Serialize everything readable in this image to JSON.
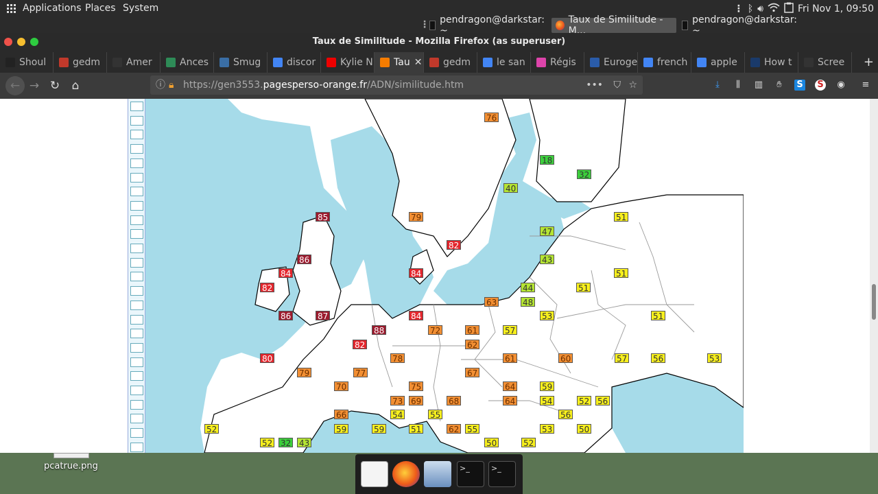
{
  "top_panel": {
    "menus": [
      "Applications",
      "Places",
      "System"
    ],
    "clock": "Fri Nov 1, 09:50"
  },
  "window_list": [
    {
      "label": "pendragon@darkstar: ~",
      "active": false
    },
    {
      "label": "Taux de Similitude - M...",
      "active": true
    },
    {
      "label": "pendragon@darkstar: ~",
      "active": false
    }
  ],
  "window": {
    "title": "Taux de Similitude - Mozilla Firefox (as superuser)"
  },
  "tabs": [
    {
      "label": "Shoul",
      "color": "#222"
    },
    {
      "label": "gedm",
      "color": "#c0392b"
    },
    {
      "label": "Amer",
      "color": "#333"
    },
    {
      "label": "Ances",
      "color": "#2e8b57"
    },
    {
      "label": "Smug",
      "color": "#3a6ea5"
    },
    {
      "label": "discor",
      "color": "#4285f4"
    },
    {
      "label": "Kylie N",
      "color": "#e00"
    },
    {
      "label": "Tau",
      "color": "#f57c00",
      "active": true
    },
    {
      "label": "gedm",
      "color": "#c0392b"
    },
    {
      "label": "le san",
      "color": "#4285f4"
    },
    {
      "label": "Régis",
      "color": "#d4a"
    },
    {
      "label": "Euroge",
      "color": "#2a5caa"
    },
    {
      "label": "french",
      "color": "#4285f4"
    },
    {
      "label": "apple",
      "color": "#4285f4"
    },
    {
      "label": "How t",
      "color": "#1a3a6a"
    },
    {
      "label": "Scree",
      "color": "#333"
    }
  ],
  "url": {
    "prefix": "https://gen3553.",
    "domain": "pagesperso-orange.fr",
    "path": "/ADN/similitude.htm"
  },
  "desktop": {
    "file_label": "pcatrue.png"
  },
  "map": {
    "sea_color": "#a6dbe9",
    "labels": [
      {
        "v": "76",
        "c": "orange"
      },
      {
        "v": "18",
        "c": "green"
      },
      {
        "v": "32",
        "c": "green"
      },
      {
        "v": "40",
        "c": "lime"
      },
      {
        "v": "85",
        "c": "darkred"
      },
      {
        "v": "79",
        "c": "orange"
      },
      {
        "v": "82",
        "c": "red"
      },
      {
        "v": "51",
        "c": "yellow"
      },
      {
        "v": "47",
        "c": "lime"
      },
      {
        "v": "86",
        "c": "darkred"
      },
      {
        "v": "43",
        "c": "lime"
      },
      {
        "v": "84",
        "c": "red"
      },
      {
        "v": "84",
        "c": "red"
      },
      {
        "v": "51",
        "c": "yellow"
      },
      {
        "v": "82",
        "c": "red"
      },
      {
        "v": "44",
        "c": "lime"
      },
      {
        "v": "51",
        "c": "yellow"
      },
      {
        "v": "63",
        "c": "orange"
      },
      {
        "v": "48",
        "c": "lime"
      },
      {
        "v": "86",
        "c": "darkred"
      },
      {
        "v": "87",
        "c": "darkred"
      },
      {
        "v": "84",
        "c": "red"
      },
      {
        "v": "53",
        "c": "yellow"
      },
      {
        "v": "51",
        "c": "yellow"
      },
      {
        "v": "88",
        "c": "darkred"
      },
      {
        "v": "72",
        "c": "orange"
      },
      {
        "v": "61",
        "c": "orange"
      },
      {
        "v": "57",
        "c": "yellow"
      },
      {
        "v": "82",
        "c": "red"
      },
      {
        "v": "62",
        "c": "orange"
      },
      {
        "v": "80",
        "c": "red"
      },
      {
        "v": "78",
        "c": "orange"
      },
      {
        "v": "61",
        "c": "orange"
      },
      {
        "v": "60",
        "c": "orange"
      },
      {
        "v": "57",
        "c": "yellow"
      },
      {
        "v": "56",
        "c": "yellow"
      },
      {
        "v": "53",
        "c": "yellow"
      },
      {
        "v": "79",
        "c": "orange"
      },
      {
        "v": "77",
        "c": "orange"
      },
      {
        "v": "67",
        "c": "orange"
      },
      {
        "v": "70",
        "c": "orange"
      },
      {
        "v": "75",
        "c": "orange"
      },
      {
        "v": "64",
        "c": "orange"
      },
      {
        "v": "59",
        "c": "yellow"
      },
      {
        "v": "73",
        "c": "orange"
      },
      {
        "v": "69",
        "c": "orange"
      },
      {
        "v": "68",
        "c": "orange"
      },
      {
        "v": "64",
        "c": "orange"
      },
      {
        "v": "54",
        "c": "yellow"
      },
      {
        "v": "52",
        "c": "yellow"
      },
      {
        "v": "56",
        "c": "yellow"
      },
      {
        "v": "66",
        "c": "orange"
      },
      {
        "v": "54",
        "c": "yellow"
      },
      {
        "v": "55",
        "c": "yellow"
      },
      {
        "v": "56",
        "c": "yellow"
      },
      {
        "v": "52",
        "c": "yellow"
      },
      {
        "v": "59",
        "c": "yellow"
      },
      {
        "v": "59",
        "c": "yellow"
      },
      {
        "v": "51",
        "c": "yellow"
      },
      {
        "v": "62",
        "c": "orange"
      },
      {
        "v": "55",
        "c": "yellow"
      },
      {
        "v": "53",
        "c": "yellow"
      },
      {
        "v": "50",
        "c": "yellow"
      },
      {
        "v": "52",
        "c": "yellow"
      },
      {
        "v": "32",
        "c": "green"
      },
      {
        "v": "43",
        "c": "lime"
      },
      {
        "v": "50",
        "c": "yellow"
      },
      {
        "v": "52",
        "c": "yellow"
      }
    ],
    "color_map": {
      "darkred": "#9c1b2e",
      "red": "#e3262d",
      "orange": "#f28f33",
      "yellow": "#f7ef1d",
      "lime": "#b5e532",
      "green": "#3ccf3c"
    }
  }
}
